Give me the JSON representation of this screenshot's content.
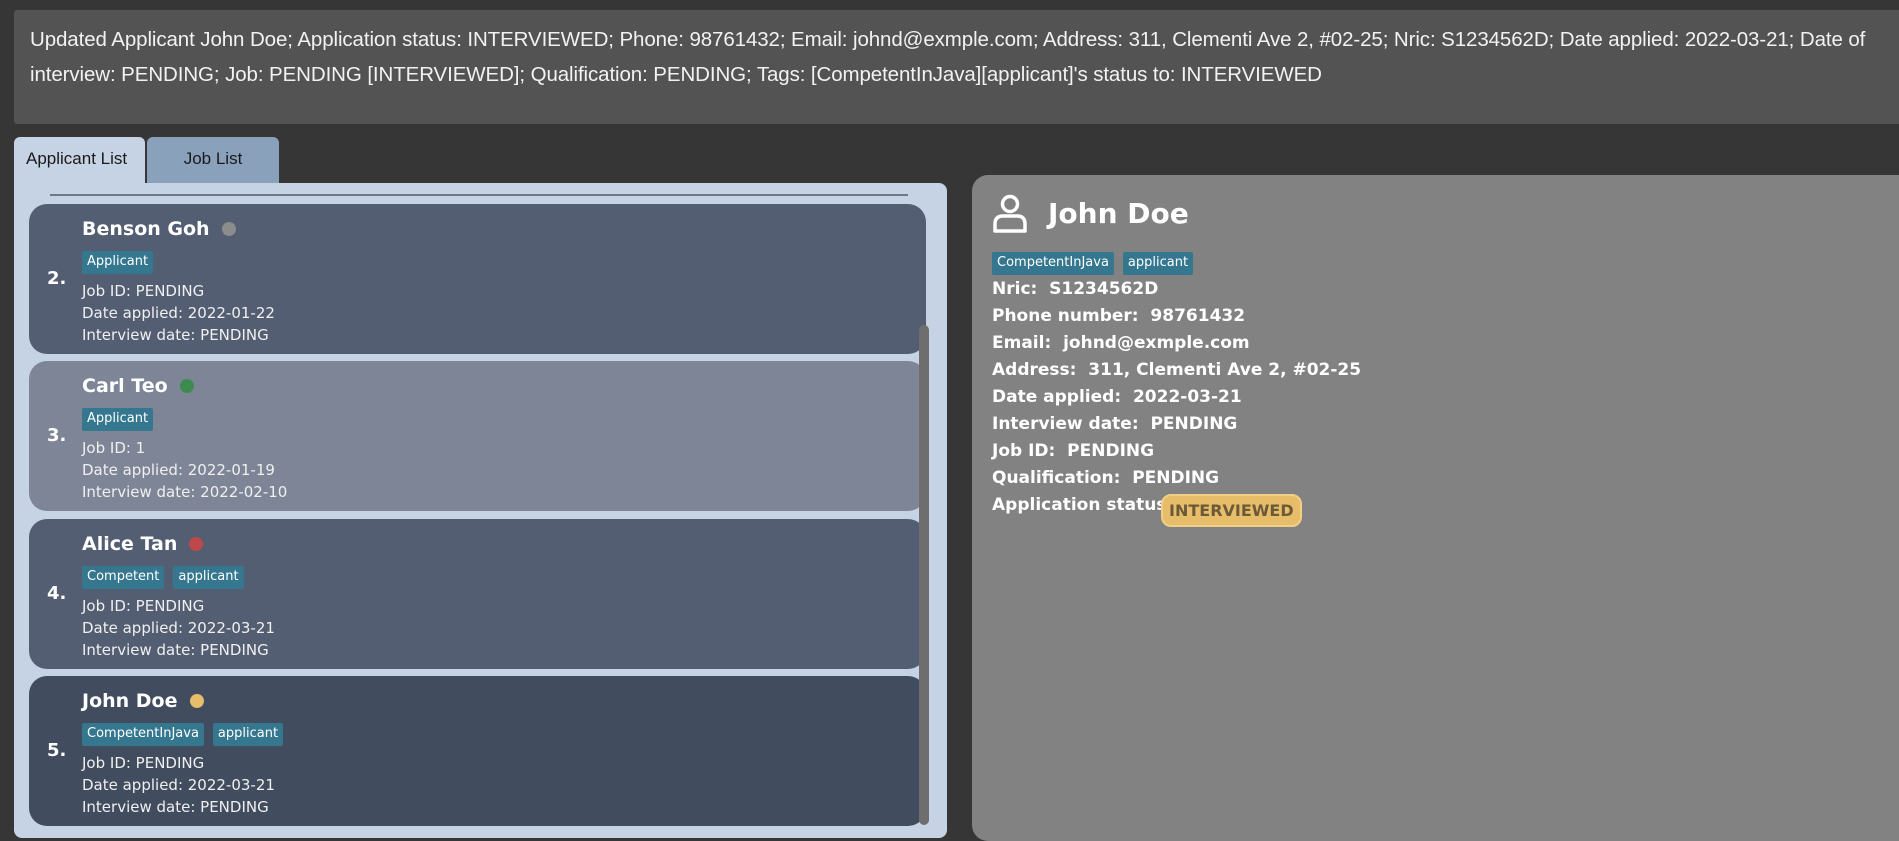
{
  "result_message": "Updated Applicant John Doe; Application status: INTERVIEWED; Phone: 98761432; Email: johnd@exmple.com; Address: 311, Clementi Ave 2, #02-25; Nric: S1234562D; Date applied: 2022-03-21; Date of interview: PENDING; Job: PENDING [INTERVIEWED]; Qualification: PENDING; Tags: [CompetentInJava][applicant]'s status to: INTERVIEWED",
  "tabs": [
    {
      "label": "Applicant List",
      "active": true
    },
    {
      "label": "Job List",
      "active": false
    }
  ],
  "applicants": [
    {
      "index": "2.",
      "name": "Benson Goh",
      "status_color": "#8c8c8c",
      "bg": "#535e72",
      "tags": [
        "Applicant"
      ],
      "job_id": "Job ID: PENDING",
      "date_applied": "Date applied: 2022-01-22",
      "interview_date": "Interview date: PENDING"
    },
    {
      "index": "3.",
      "name": "Carl Teo",
      "status_color": "#3d8b4e",
      "bg": "#7d8597",
      "tags": [
        "Applicant"
      ],
      "job_id": "Job ID: 1",
      "date_applied": "Date applied: 2022-01-19",
      "interview_date": "Interview date: 2022-02-10"
    },
    {
      "index": "4.",
      "name": "Alice Tan",
      "status_color": "#c0484a",
      "bg": "#535e72",
      "tags": [
        "Competent",
        "applicant"
      ],
      "job_id": "Job ID: PENDING",
      "date_applied": "Date applied: 2022-03-21",
      "interview_date": "Interview date: PENDING"
    },
    {
      "index": "5.",
      "name": "John Doe",
      "status_color": "#e8bd69",
      "bg": "#414c5f",
      "tags": [
        "CompetentInJava",
        "applicant"
      ],
      "job_id": "Job ID: PENDING",
      "date_applied": "Date applied: 2022-03-21",
      "interview_date": "Interview date: PENDING"
    }
  ],
  "detail": {
    "name": "John Doe",
    "tags": [
      "CompetentInJava",
      "applicant"
    ],
    "nric": "Nric:  S1234562D",
    "phone": "Phone number:  98761432",
    "email": "Email:  johnd@exmple.com",
    "address": "Address:  311, Clementi Ave 2, #02-25",
    "date_applied": "Date applied:  2022-03-21",
    "interview_date": "Interview date:  PENDING",
    "job_id": "Job ID:  PENDING",
    "qualification": "Qualification:  PENDING",
    "status_label": "Application status:",
    "status_value": "INTERVIEWED"
  }
}
